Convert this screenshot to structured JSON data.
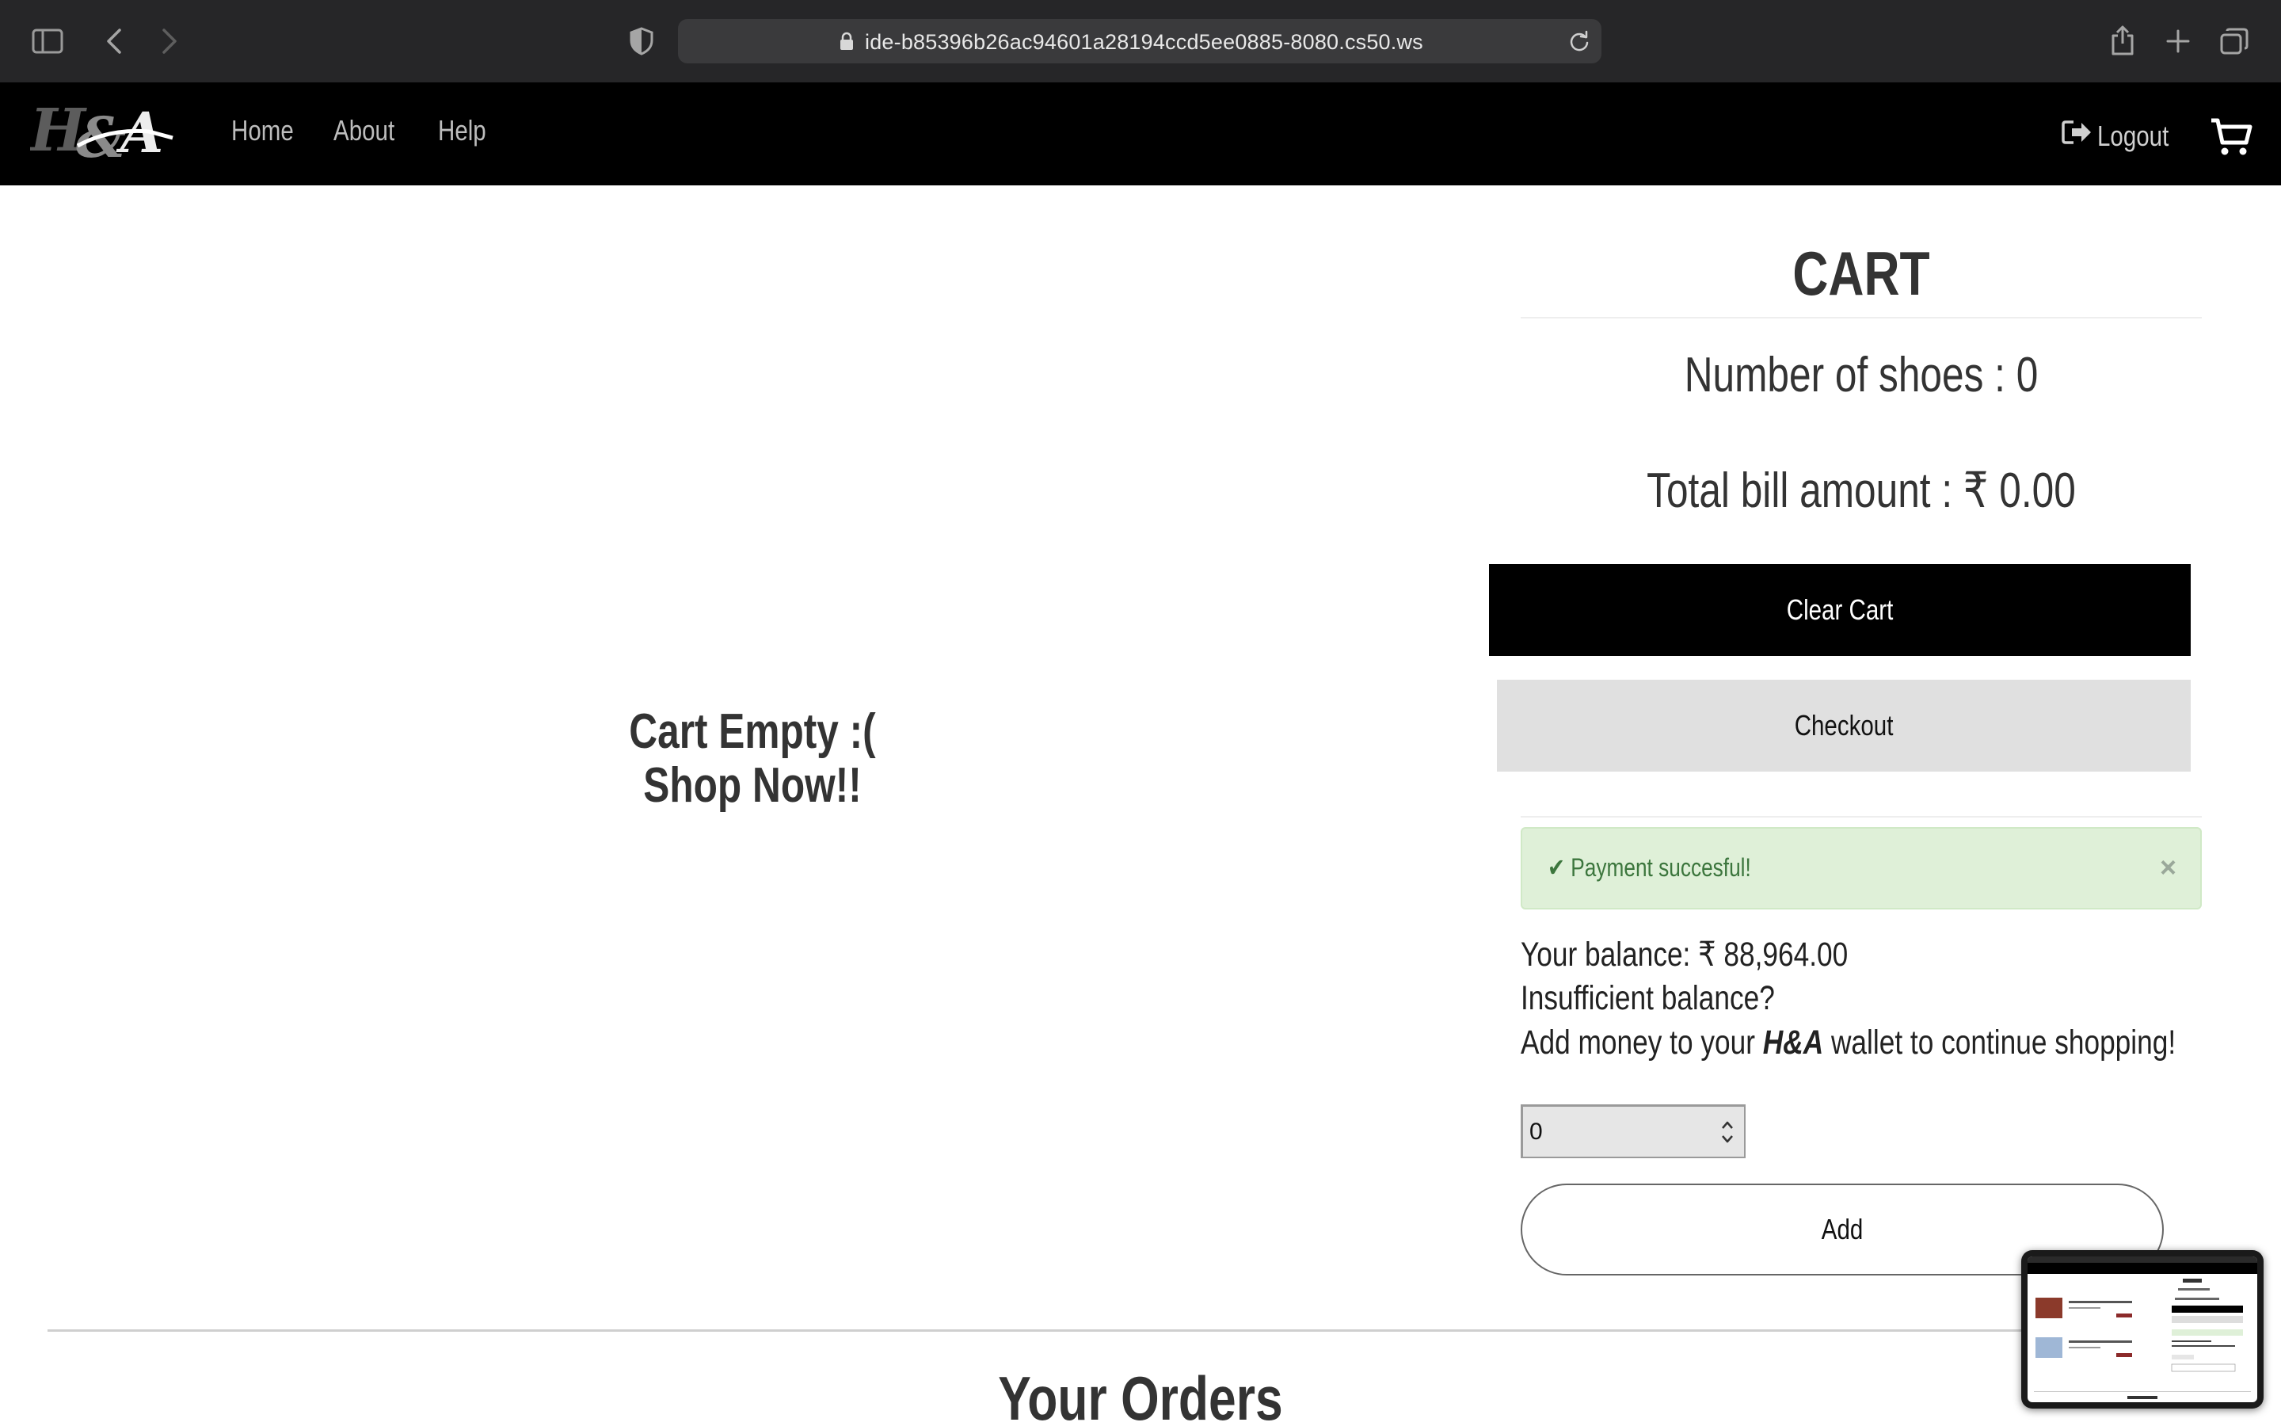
{
  "browser": {
    "url": "ide-b85396b26ac94601a28194ccd5ee0885-8080.cs50.ws"
  },
  "nav": {
    "brand": "H&A",
    "links": [
      "Home",
      "About",
      "Help"
    ],
    "logout_label": "Logout"
  },
  "empty_state": {
    "line1": "Cart Empty :(",
    "line2": "Shop Now!!"
  },
  "cart": {
    "title": "CART",
    "count_text": "Number of shoes : 0",
    "total_text": "Total bill amount : ₹ 0.00",
    "clear_label": "Clear Cart",
    "checkout_label": "Checkout"
  },
  "alert": {
    "check": "✔",
    "message": "Payment succesful!",
    "close": "×"
  },
  "wallet": {
    "balance_text": "Your balance: ₹ 88,964.00",
    "insufficient_text": "Insufficient balance?",
    "add_money_prefix": "Add money to your",
    "brand": "H&A",
    "add_money_suffix": "wallet to continue shopping!",
    "amount_value": "0",
    "add_label": "Add"
  },
  "orders": {
    "heading": "Your Orders"
  },
  "colors": {
    "nav_bg": "#000000",
    "alert_bg": "#dff0d8",
    "alert_text": "#3c763d",
    "checkout_bg": "#e0e0e0"
  },
  "icons": {
    "sidebar": "sidebar-icon",
    "back": "chevron-left-icon",
    "forward": "chevron-right-icon",
    "shield": "shield-icon",
    "lock": "lock-icon",
    "reload": "reload-icon",
    "share": "share-icon",
    "new_tab": "plus-icon",
    "tabs": "tabs-icon",
    "logout": "logout-icon",
    "cart": "cart-icon"
  }
}
